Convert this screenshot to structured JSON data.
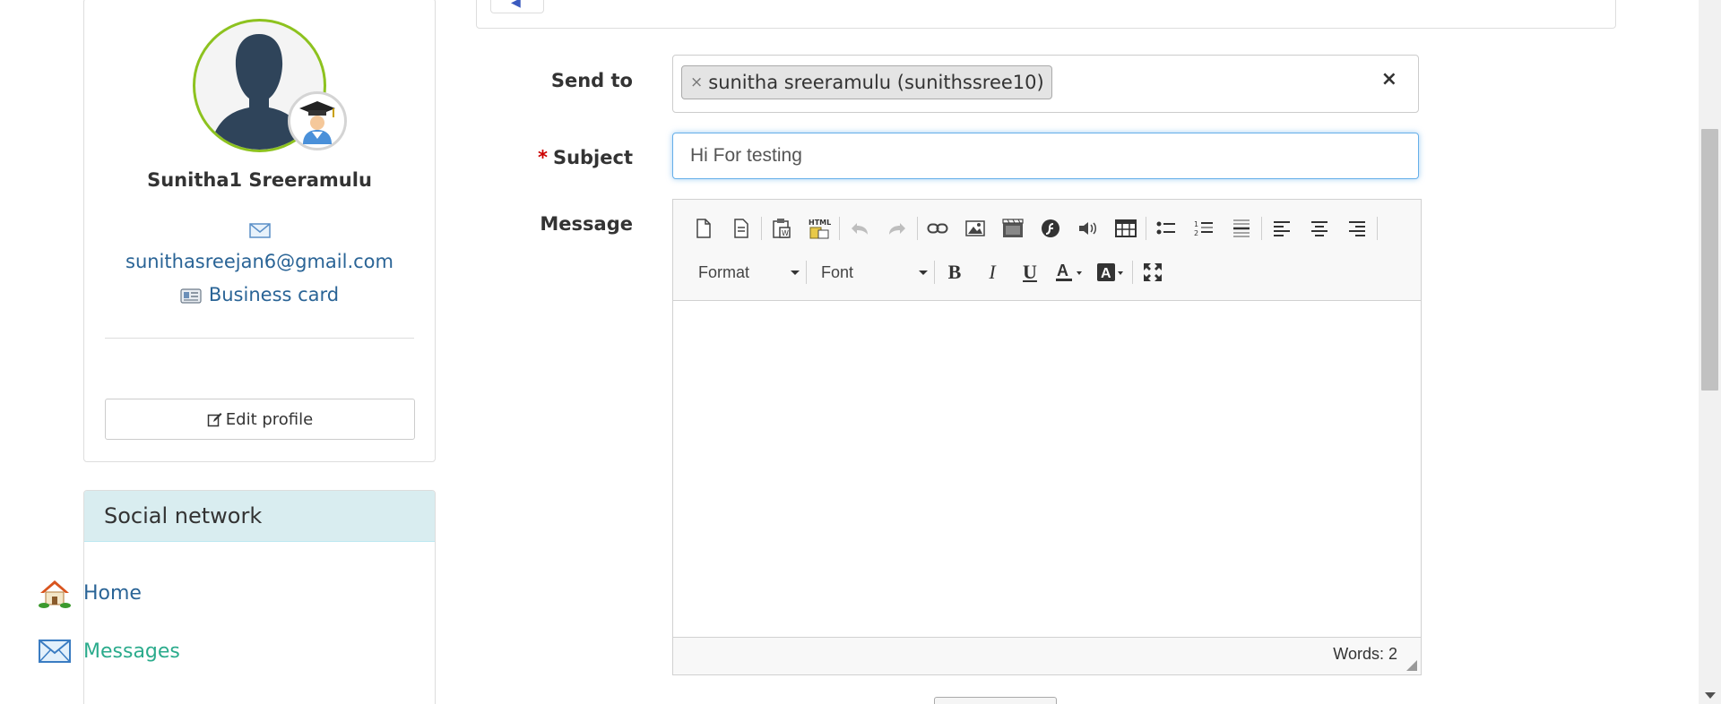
{
  "profile": {
    "name": "Sunitha1 Sreeramulu",
    "email": "sunithasreejan6@gmail.com",
    "business_card_label": "Business card",
    "edit_profile_label": "Edit profile",
    "ring_color": "#8dc21f"
  },
  "social": {
    "header": "Social network",
    "items": [
      {
        "label": "Home",
        "icon": "home-icon"
      },
      {
        "label": "Messages",
        "icon": "envelope-icon"
      }
    ]
  },
  "form": {
    "send_to_label": "Send to",
    "subject_label": "Subject",
    "required_marker": "*",
    "message_label": "Message",
    "recipients": [
      {
        "label": "sunitha sreeramulu (sunithssree10)"
      }
    ],
    "remove_tag_glyph": "×",
    "clear_all_glyph": "×",
    "subject_value": "Hi For testing"
  },
  "editor": {
    "format_label": "Format",
    "font_label": "Font",
    "word_count": "Words: 2",
    "bold_glyph": "B",
    "italic_glyph": "I",
    "underline_glyph": "U"
  },
  "colors": {
    "link": "#2a6496",
    "active_link": "#2bab8c",
    "required": "#cc0000",
    "focus_border": "#66afe9",
    "panel_header_bg": "#d9edf0"
  }
}
